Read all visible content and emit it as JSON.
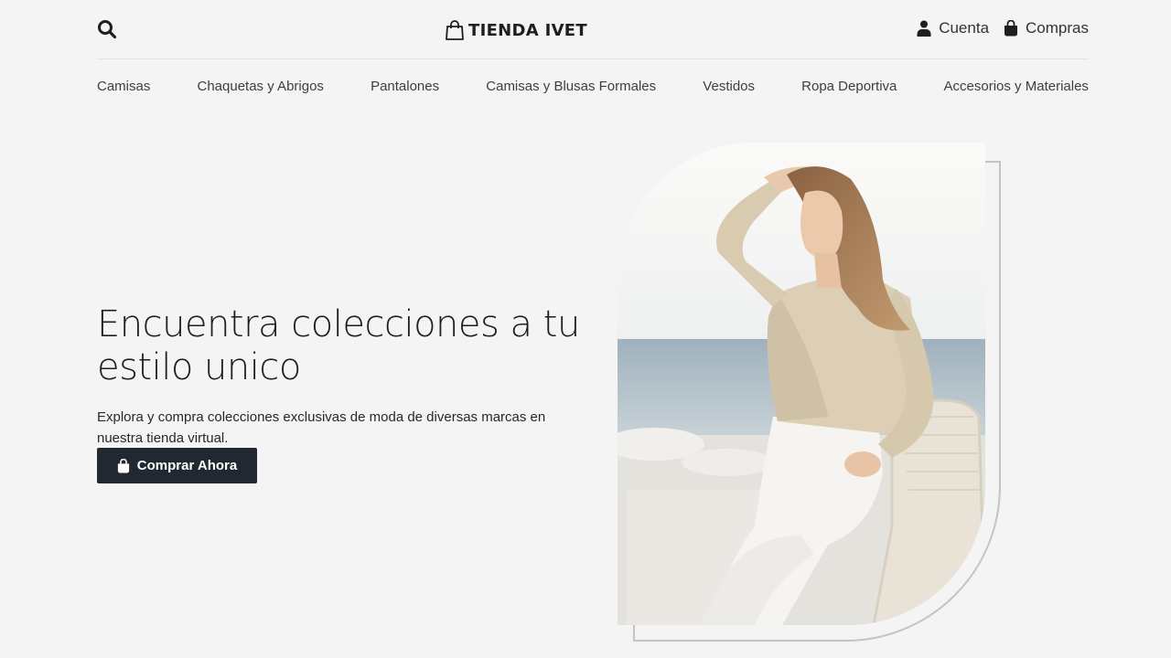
{
  "brand": {
    "name": "TIENDA IVET"
  },
  "header": {
    "account_label": "Cuenta",
    "cart_label": "Compras"
  },
  "nav": {
    "items": [
      "Camisas",
      "Chaquetas y Abrigos",
      "Pantalones",
      "Camisas y Blusas Formales",
      "Vestidos",
      "Ropa Deportiva",
      "Accesorios y Materiales"
    ]
  },
  "hero": {
    "title": "Encuentra colecciones a tu estilo unico",
    "subtitle": "Explora y compra colecciones exclusivas de moda de diversas marcas en nuestra tienda virtual.",
    "cta_label": "Comprar Ahora"
  },
  "colors": {
    "background": "#f4f4f4",
    "button": "#212832",
    "text": "#1b1e22"
  },
  "icons": {
    "search": "search-icon",
    "logo": "shopping-bag-outline-icon",
    "account": "user-icon",
    "cart": "shopping-bag-icon",
    "cta": "shopping-bag-icon"
  }
}
